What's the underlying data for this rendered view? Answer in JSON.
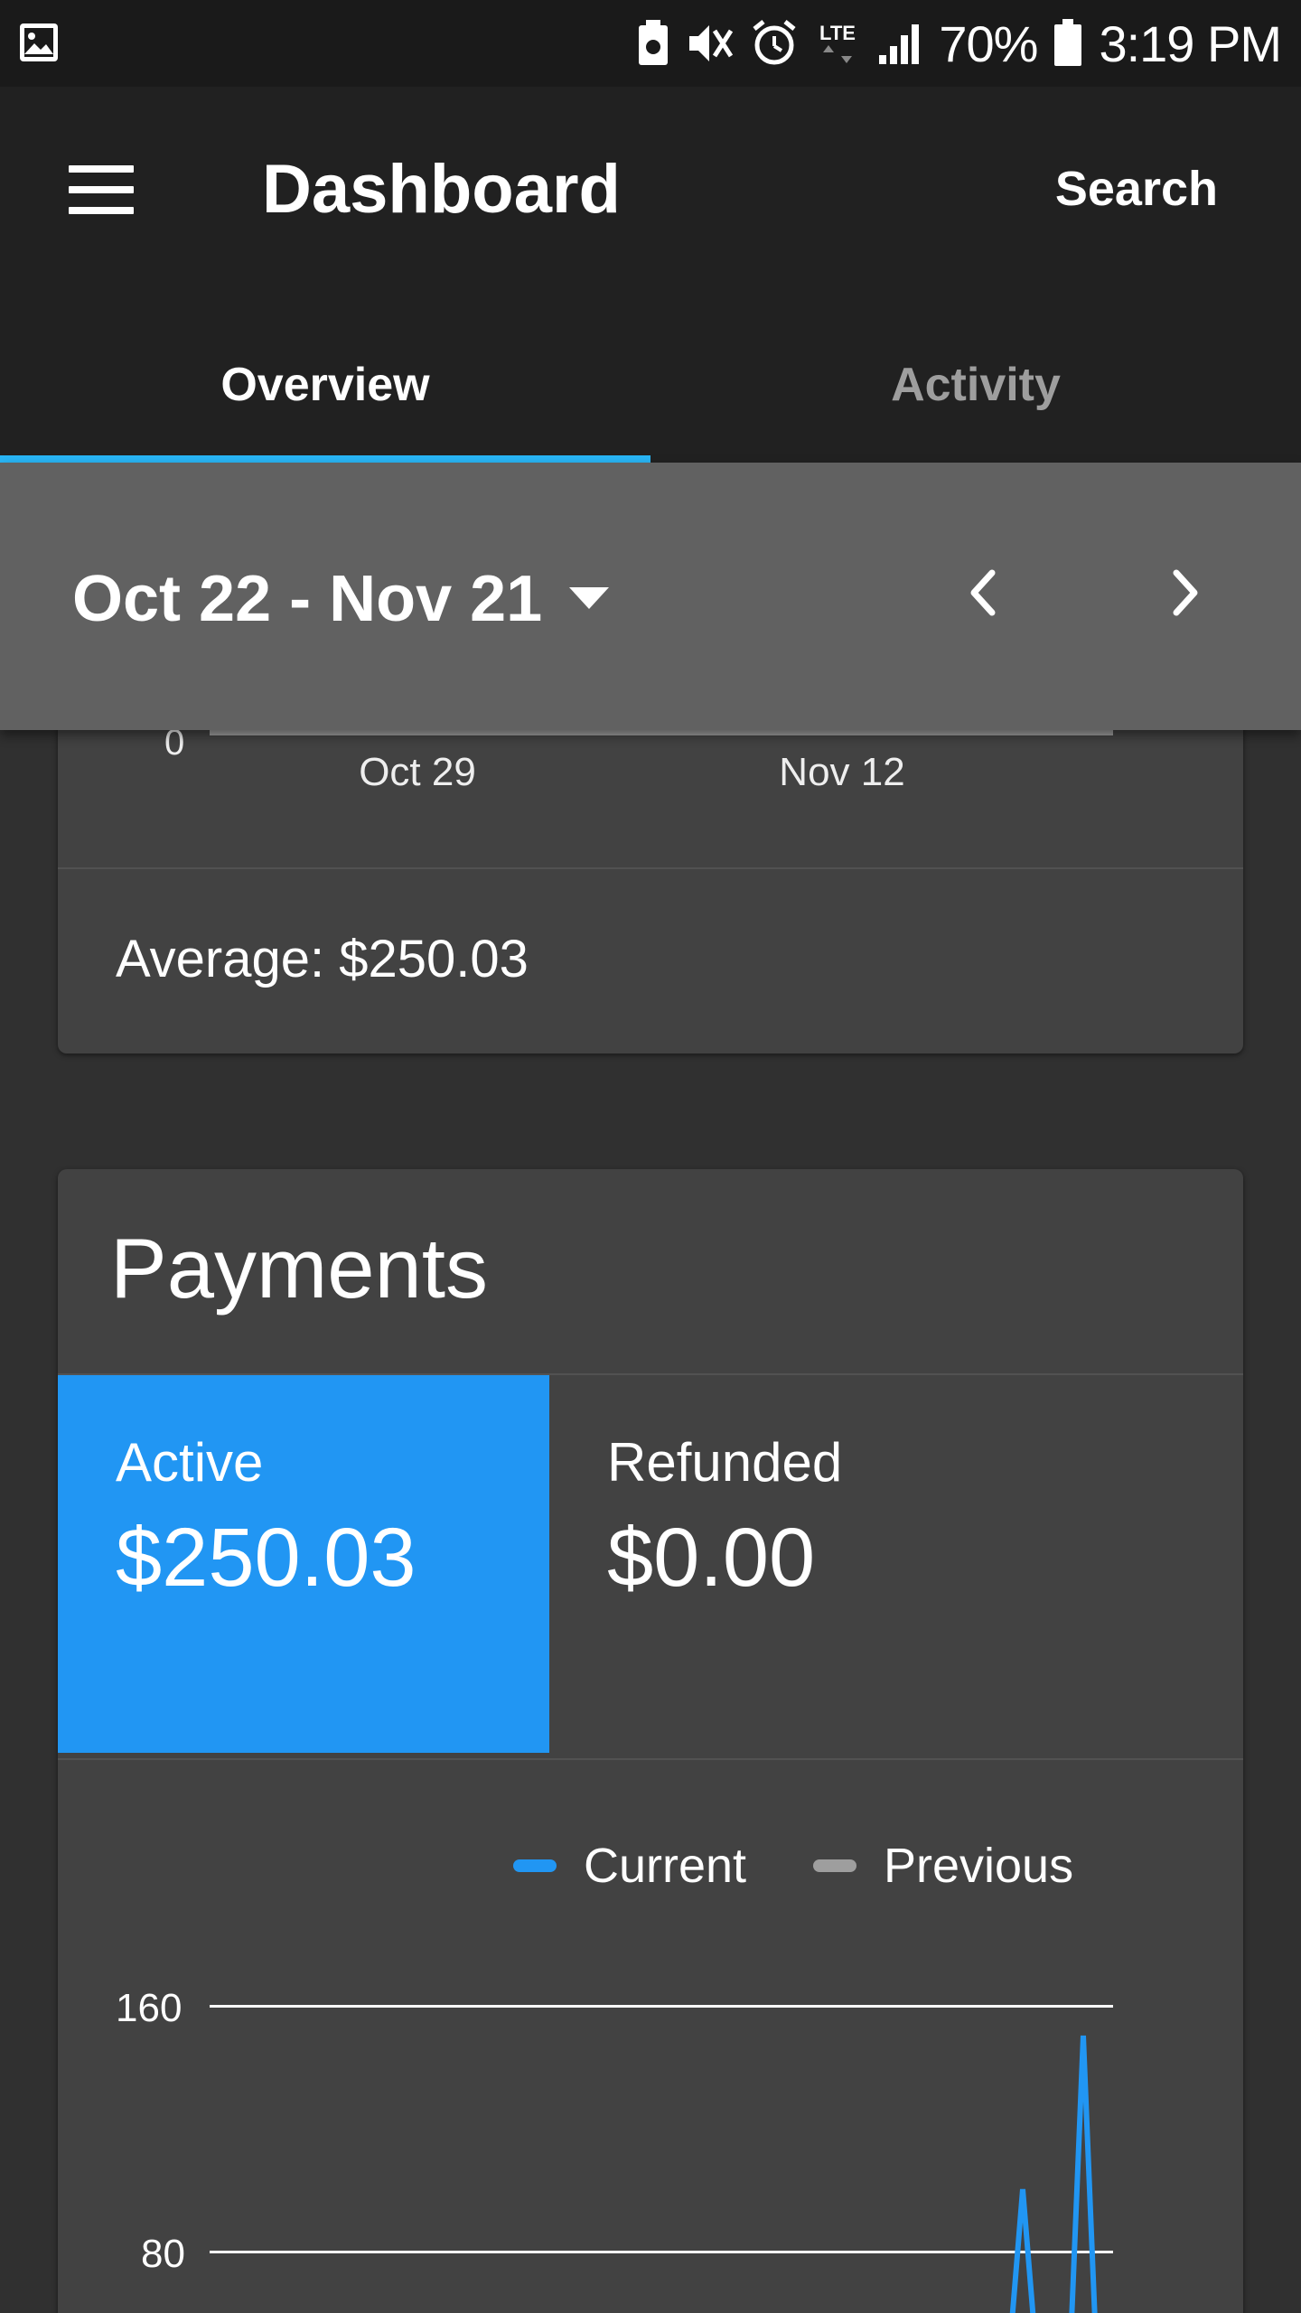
{
  "status_bar": {
    "battery": "70%",
    "time": "3:19 PM",
    "network": "LTE",
    "icons": [
      "gallery-icon",
      "battery-saver-icon",
      "mute-vibrate-icon",
      "alarm-icon",
      "lte-icon",
      "signal-icon",
      "battery-icon"
    ]
  },
  "app_bar": {
    "title": "Dashboard",
    "search_label": "Search",
    "menu_icon": "menu-icon"
  },
  "tabs": [
    {
      "label": "Overview",
      "selected": true
    },
    {
      "label": "Activity",
      "selected": false
    }
  ],
  "colors": {
    "accent": "#29b6f6",
    "active_card": "#2196f3",
    "current_series": "#2196f3",
    "previous_series": "#9e9e9e",
    "card_bg": "#424242",
    "page_bg": "#303030"
  },
  "date_range": {
    "label": "Oct 22 - Nov 21",
    "dropdown_icon": "caret-down-icon",
    "prev_icon": "chevron-left-icon",
    "next_icon": "chevron-right-icon"
  },
  "sales_card": {
    "y_zero_label": "0",
    "x_ticks": [
      "Oct 29",
      "Nov 12"
    ],
    "average": "Average: $250.03"
  },
  "payments": {
    "title": "Payments",
    "stats": [
      {
        "label": "Active",
        "value": "$250.03",
        "selected": true
      },
      {
        "label": "Refunded",
        "value": "$0.00",
        "selected": false
      }
    ],
    "legend": [
      {
        "name": "Current"
      },
      {
        "name": "Previous"
      }
    ]
  },
  "chart_data": {
    "type": "line",
    "title": "",
    "xlabel": "",
    "ylabel": "",
    "ylim": [
      0,
      160
    ],
    "y_ticks": [
      80,
      160
    ],
    "grid": true,
    "legend_position": "top",
    "series": [
      {
        "name": "Current",
        "visible_peaks": [
          100,
          150
        ]
      },
      {
        "name": "Previous",
        "visible_peaks": []
      }
    ]
  }
}
